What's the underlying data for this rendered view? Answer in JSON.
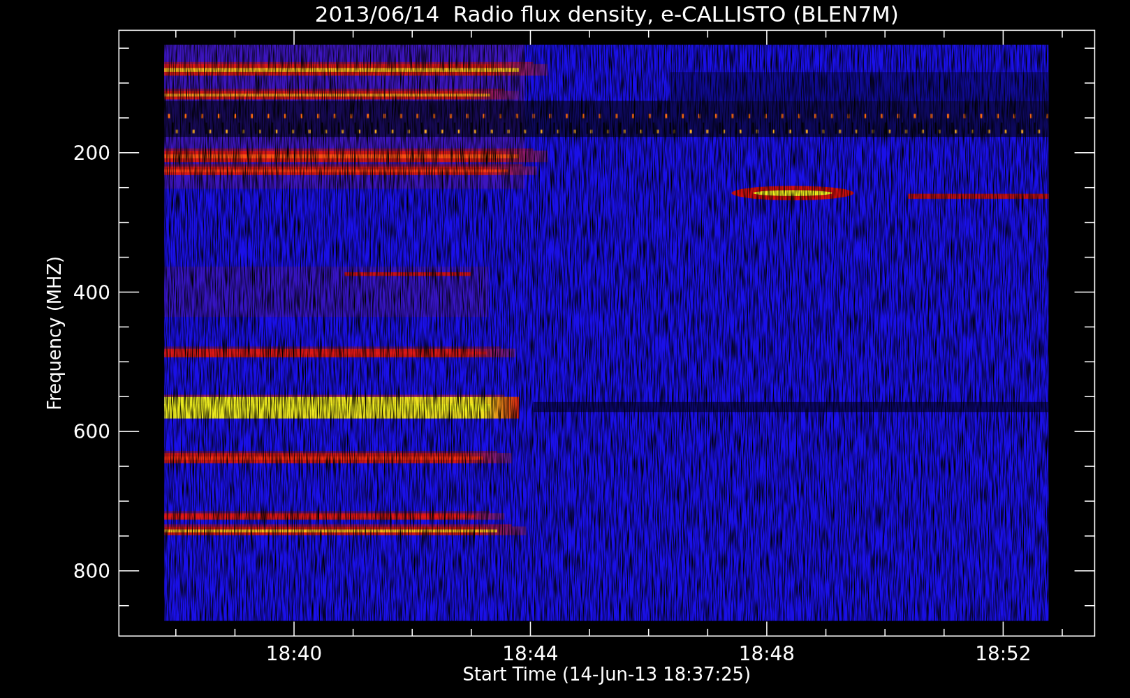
{
  "title": "2013/06/14  Radio flux density, e-CALLISTO (BLEN7M)",
  "y_axis": {
    "label": "Frequency (MHZ)",
    "ticks": [
      "200",
      "400",
      "600",
      "800"
    ]
  },
  "x_axis": {
    "label": "Start Time (14-Jun-13 18:37:25)",
    "ticks": [
      "18:40",
      "18:44",
      "18:48",
      "18:52"
    ]
  }
}
